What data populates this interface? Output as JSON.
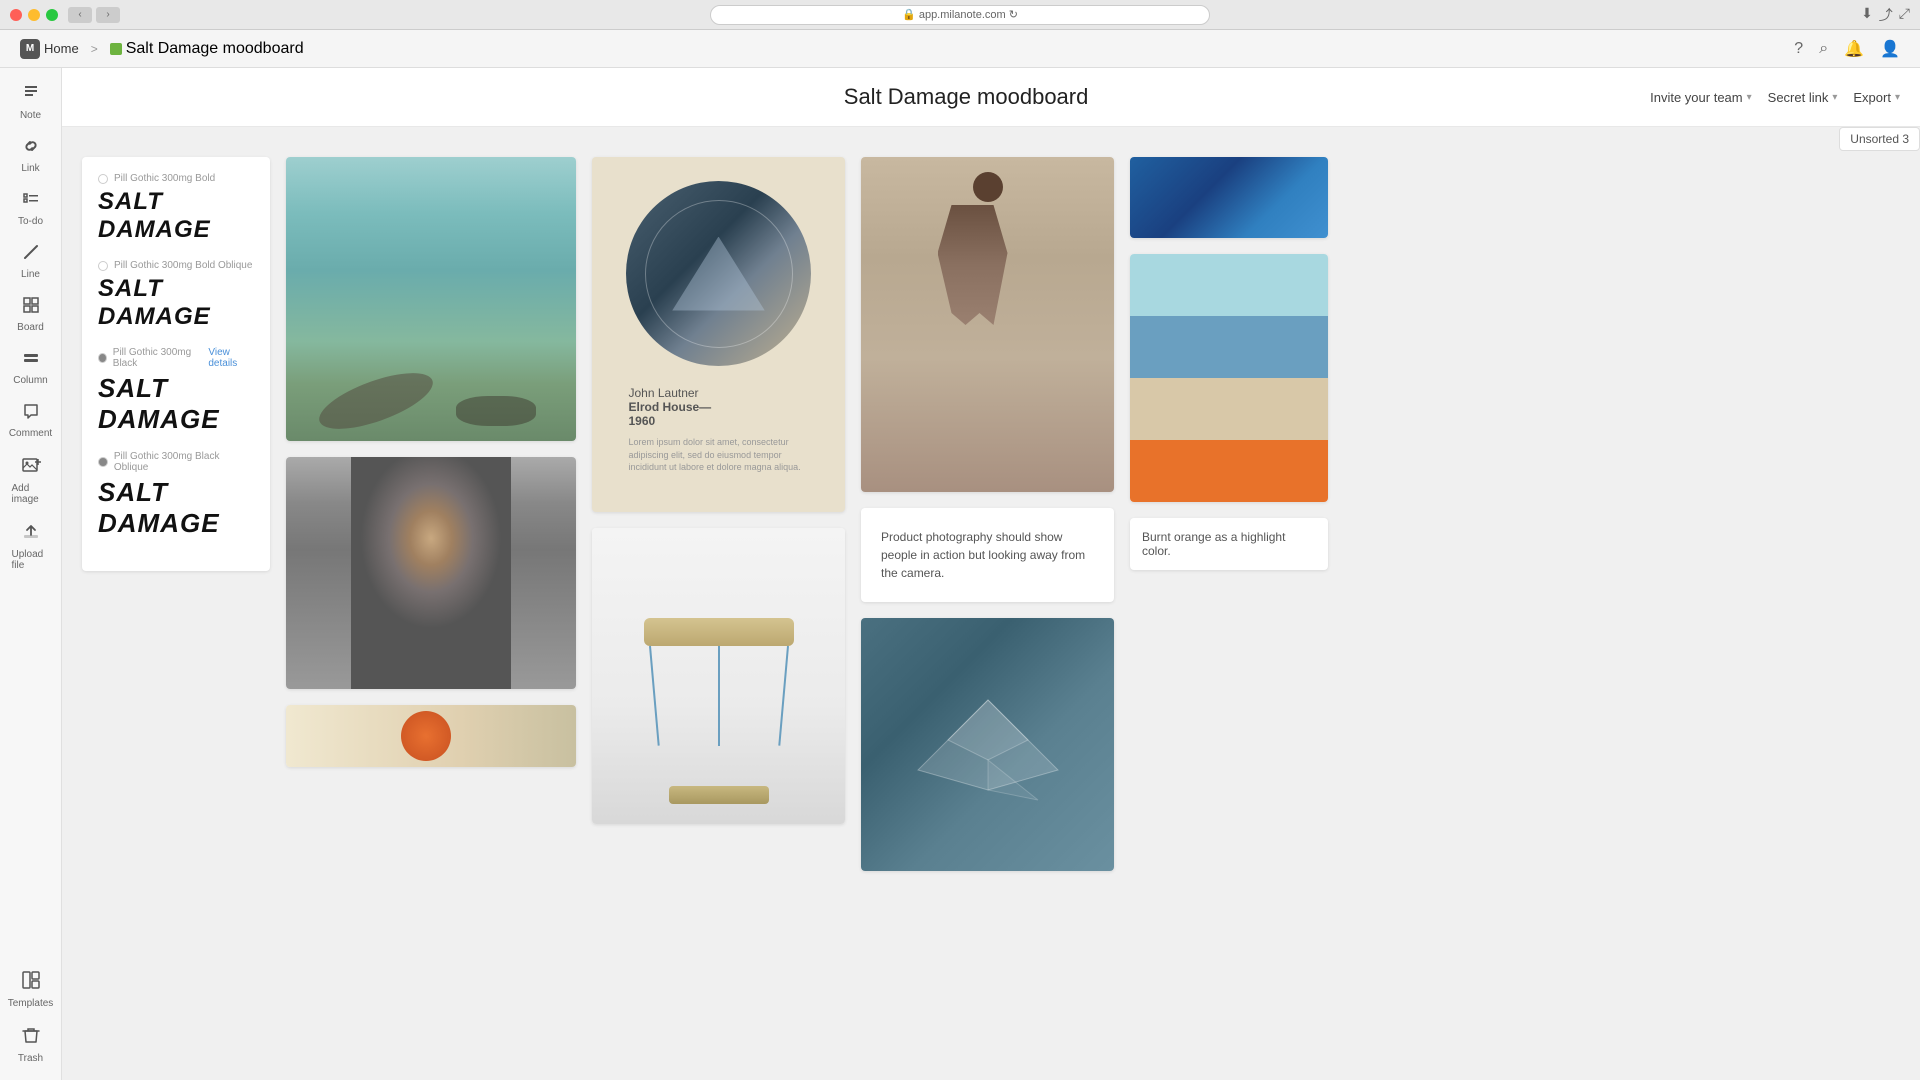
{
  "window": {
    "url": "app.milanote.com",
    "title": "Salt Damage moodboard"
  },
  "breadcrumb": {
    "home": "Home",
    "separator": ">",
    "current": "Salt Damage moodboard"
  },
  "header": {
    "title": "Salt Damage moodboard",
    "invite_label": "Invite your team",
    "secret_link_label": "Secret link",
    "export_label": "Export",
    "sort_label": "Unsorted 3"
  },
  "sidebar": {
    "items": [
      {
        "id": "note",
        "label": "Note",
        "icon": "≡"
      },
      {
        "id": "link",
        "label": "Link",
        "icon": "⌘"
      },
      {
        "id": "todo",
        "label": "To-do",
        "icon": "☰"
      },
      {
        "id": "line",
        "label": "Line",
        "icon": "╱"
      },
      {
        "id": "board",
        "label": "Board",
        "icon": "⊞"
      },
      {
        "id": "column",
        "label": "Column",
        "icon": "▬"
      },
      {
        "id": "comment",
        "label": "Comment",
        "icon": "💬"
      },
      {
        "id": "add-image",
        "label": "Add image",
        "icon": "🖼"
      },
      {
        "id": "upload-file",
        "label": "Upload file",
        "icon": "⬆"
      },
      {
        "id": "templates",
        "label": "Templates",
        "icon": "◧"
      },
      {
        "id": "trash",
        "label": "Trash",
        "icon": "🗑"
      }
    ]
  },
  "typography": {
    "font_name": "Pill Gothic 300mg",
    "variants": [
      {
        "label": "Pill Gothic 300mg Bold",
        "text": "SALT DAMAGE",
        "style": "bold"
      },
      {
        "label": "Pill Gothic 300mg Bold Oblique",
        "text": "SALT DAMAGE",
        "style": "bold-italic"
      },
      {
        "label": "Pill Gothic 300mg Black",
        "text": "SALT DAMAGE",
        "style": "black",
        "action": "View details"
      },
      {
        "label": "Pill Gothic 300mg Black Oblique",
        "text": "SALT DAMAGE",
        "style": "black-italic"
      }
    ]
  },
  "poster": {
    "name": "John Lautner",
    "house": "Elrod House—",
    "year": "1960"
  },
  "skater_note": {
    "text": "Product photography should show people in action but looking away from the camera."
  },
  "color_note": {
    "text": "Burnt orange as a highlight color."
  },
  "colors": {
    "accent": "#e8722a",
    "brand": "#4a6db5",
    "background": "#f0f0f0",
    "sidebar_bg": "#f7f7f7"
  }
}
